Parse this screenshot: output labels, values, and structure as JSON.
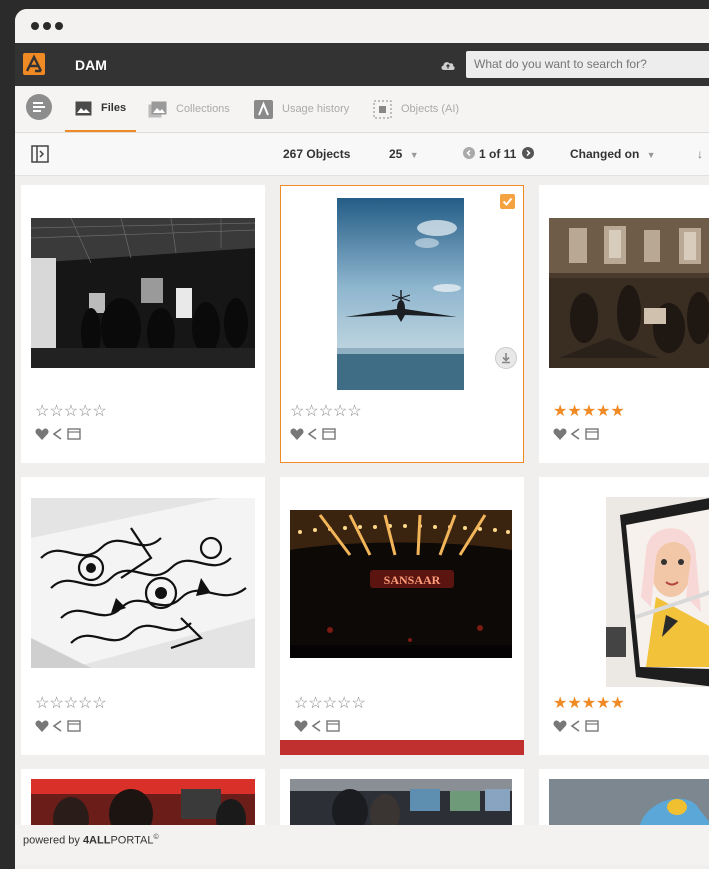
{
  "app": {
    "name": "DAM"
  },
  "search": {
    "placeholder": "What do you want to search for?"
  },
  "tabs": [
    {
      "label": "Files",
      "icon": "image-icon",
      "active": true
    },
    {
      "label": "Collections",
      "icon": "collections-icon",
      "active": false
    },
    {
      "label": "Usage history",
      "icon": "usage-history-icon",
      "active": false
    },
    {
      "label": "Objects (AI)",
      "icon": "objects-ai-icon",
      "active": false
    }
  ],
  "toolbar": {
    "count_label": "267 Objects",
    "page_size": "25",
    "pagination": "1 of 11",
    "sort_label": "Changed on"
  },
  "cards": [
    {
      "rating": 0,
      "stars": "☆☆☆☆☆",
      "selected": false
    },
    {
      "rating": 0,
      "stars": "☆☆☆☆☆",
      "selected": true
    },
    {
      "rating": 5,
      "stars": "★★★★★",
      "selected": false
    },
    {
      "rating": 0,
      "stars": "☆☆☆☆☆",
      "selected": false
    },
    {
      "rating": 0,
      "stars": "☆☆☆☆☆",
      "selected": false
    },
    {
      "rating": 5,
      "stars": "★★★★★",
      "selected": false
    }
  ],
  "footer": {
    "prefix": "powered by ",
    "brand_bold": "4ALL",
    "brand_rest": "PORTAL",
    "mark": "©"
  },
  "colors": {
    "accent": "#f08a24",
    "appbar": "#333333",
    "red_bar": "#c0302f"
  }
}
